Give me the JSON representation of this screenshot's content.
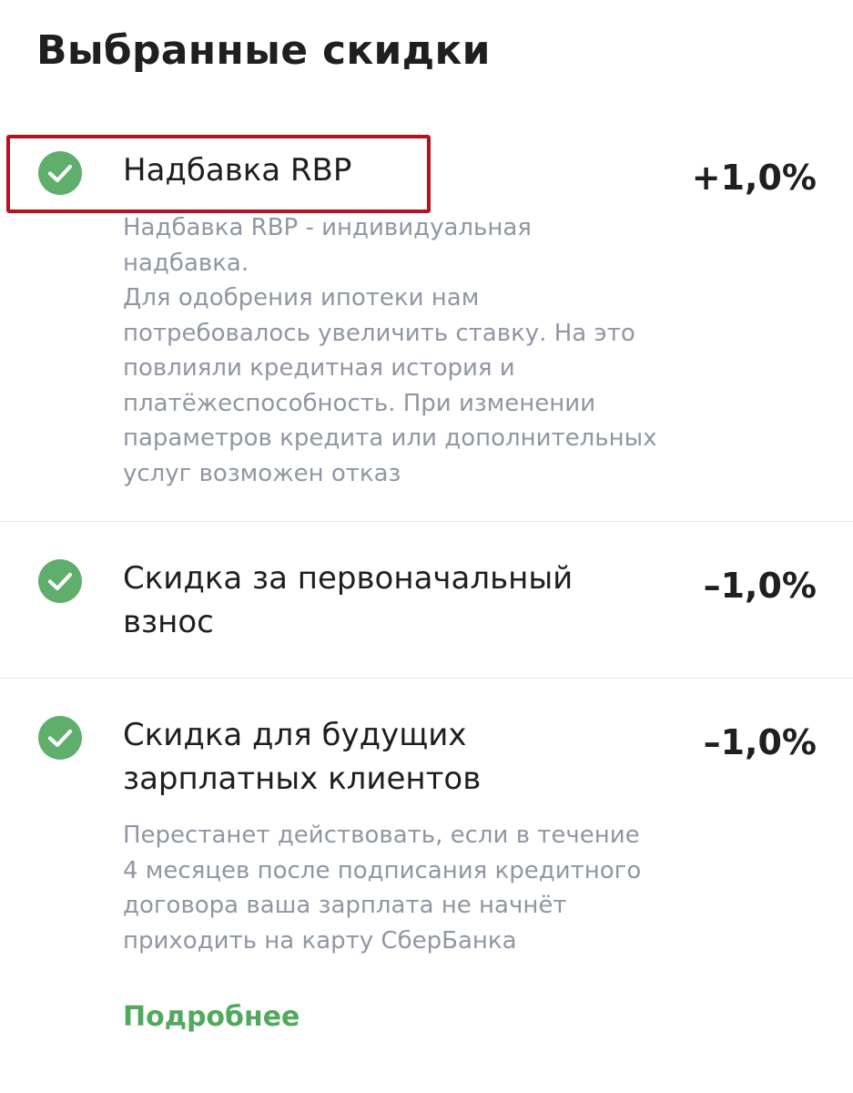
{
  "page": {
    "title": "Выбранные скидки"
  },
  "discounts": [
    {
      "title": "Надбавка RBP",
      "value": "+1,0%",
      "description": "Надбавка RBP - индивидуальная\nнадбавка.\nДля одобрения ипотеки нам\nпотребовалось увеличить ставку. На это\nповлияли кредитная история и\nплатёжеспособность. При изменении\nпараметров кредита или дополнительных\nуслуг возможен отказ",
      "icon": "check-circle-icon"
    },
    {
      "title": "Скидка за первоначальный\nвзнос",
      "value": "–1,0%",
      "icon": "check-circle-icon"
    },
    {
      "title": "Скидка для будущих\nзарплатных клиентов",
      "value": "–1,0%",
      "description": "Перестанет действовать, если в течение\n4 месяцев после подписания кредитного\nдоговора ваша зарплата не начнёт\nприходить на карту СберБанка",
      "icon": "check-circle-icon"
    }
  ],
  "more_link": {
    "label": "Подробнее"
  },
  "colors": {
    "accent_green": "#5fae6b",
    "highlight_red": "#b4121f",
    "text_primary": "#1f1f22",
    "text_secondary": "#8f97a3"
  }
}
